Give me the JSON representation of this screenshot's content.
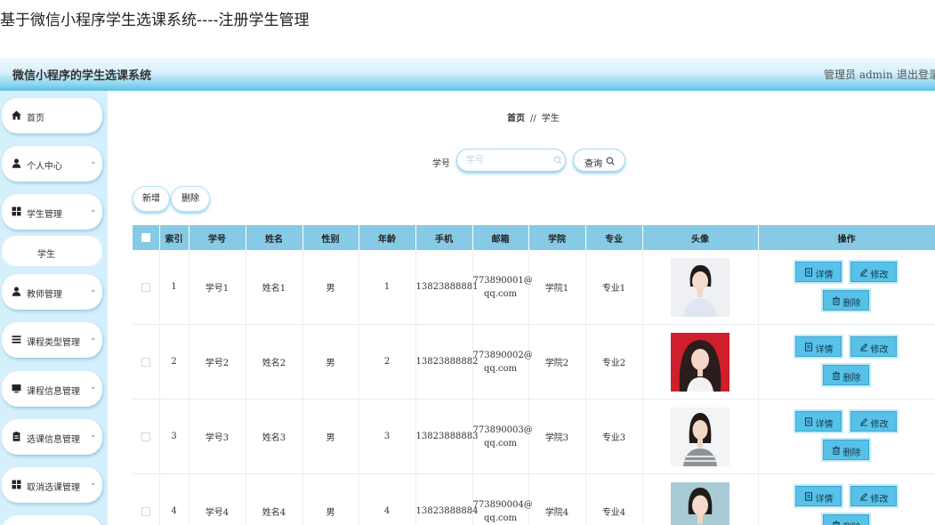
{
  "page_title": "基于微信小程序学生选课系统----注册学生管理",
  "header": {
    "app_name": "微信小程序的学生选课系统",
    "admin_text": "管理员 admin",
    "logout_label": "退出登录"
  },
  "sidebar": {
    "items": [
      {
        "label": "首页",
        "icon": "home-icon",
        "expandable": false
      },
      {
        "label": "个人中心",
        "icon": "user-icon",
        "expandable": true
      },
      {
        "label": "学生管理",
        "icon": "grid-icon",
        "expandable": true
      },
      {
        "label": "学生",
        "sub": true
      },
      {
        "label": "教师管理",
        "icon": "user-icon",
        "expandable": true
      },
      {
        "label": "课程类型管理",
        "icon": "list-icon",
        "expandable": true
      },
      {
        "label": "课程信息管理",
        "icon": "monitor-icon",
        "expandable": true
      },
      {
        "label": "选课信息管理",
        "icon": "clipboard-icon",
        "expandable": true
      },
      {
        "label": "取消选课管理",
        "icon": "grid-icon",
        "expandable": true
      }
    ]
  },
  "breadcrumb": {
    "home": "首页",
    "separator": "//",
    "current": "学生"
  },
  "search": {
    "label": "学号",
    "placeholder": "学号",
    "button": "查询"
  },
  "toolbar": {
    "add": "新增",
    "delete": "删除"
  },
  "table": {
    "headers": [
      "索引",
      "学号",
      "姓名",
      "性别",
      "年龄",
      "手机",
      "邮箱",
      "学院",
      "专业",
      "头像",
      "操作"
    ],
    "rows": [
      {
        "index": "1",
        "student_no": "学号1",
        "name": "姓名1",
        "gender": "男",
        "age": "1",
        "phone": "13823888881",
        "email_1": "773890001@",
        "email_2": "qq.com",
        "college": "学院1",
        "major": "专业1",
        "photo_bg": "#eef0f3"
      },
      {
        "index": "2",
        "student_no": "学号2",
        "name": "姓名2",
        "gender": "男",
        "age": "2",
        "phone": "13823888882",
        "email_1": "773890002@",
        "email_2": "qq.com",
        "college": "学院2",
        "major": "专业2",
        "photo_bg": "#cf1f2a"
      },
      {
        "index": "3",
        "student_no": "学号3",
        "name": "姓名3",
        "gender": "男",
        "age": "3",
        "phone": "13823888883",
        "email_1": "773890003@",
        "email_2": "qq.com",
        "college": "学院3",
        "major": "专业3",
        "photo_bg": "#f3f4f6"
      },
      {
        "index": "4",
        "student_no": "学号4",
        "name": "姓名4",
        "gender": "男",
        "age": "4",
        "phone": "13823888884",
        "email_1": "773890004@",
        "email_2": "qq.com",
        "college": "学院4",
        "major": "专业4",
        "photo_bg": "#a9cbd6"
      }
    ],
    "actions": {
      "detail": "详情",
      "edit": "修改",
      "delete": "删除"
    }
  },
  "colors": {
    "header_accent": "#5dc1e6",
    "sidebar_bg": "#d5effb",
    "table_header": "#87cae5",
    "action_button": "#57c1e8"
  }
}
